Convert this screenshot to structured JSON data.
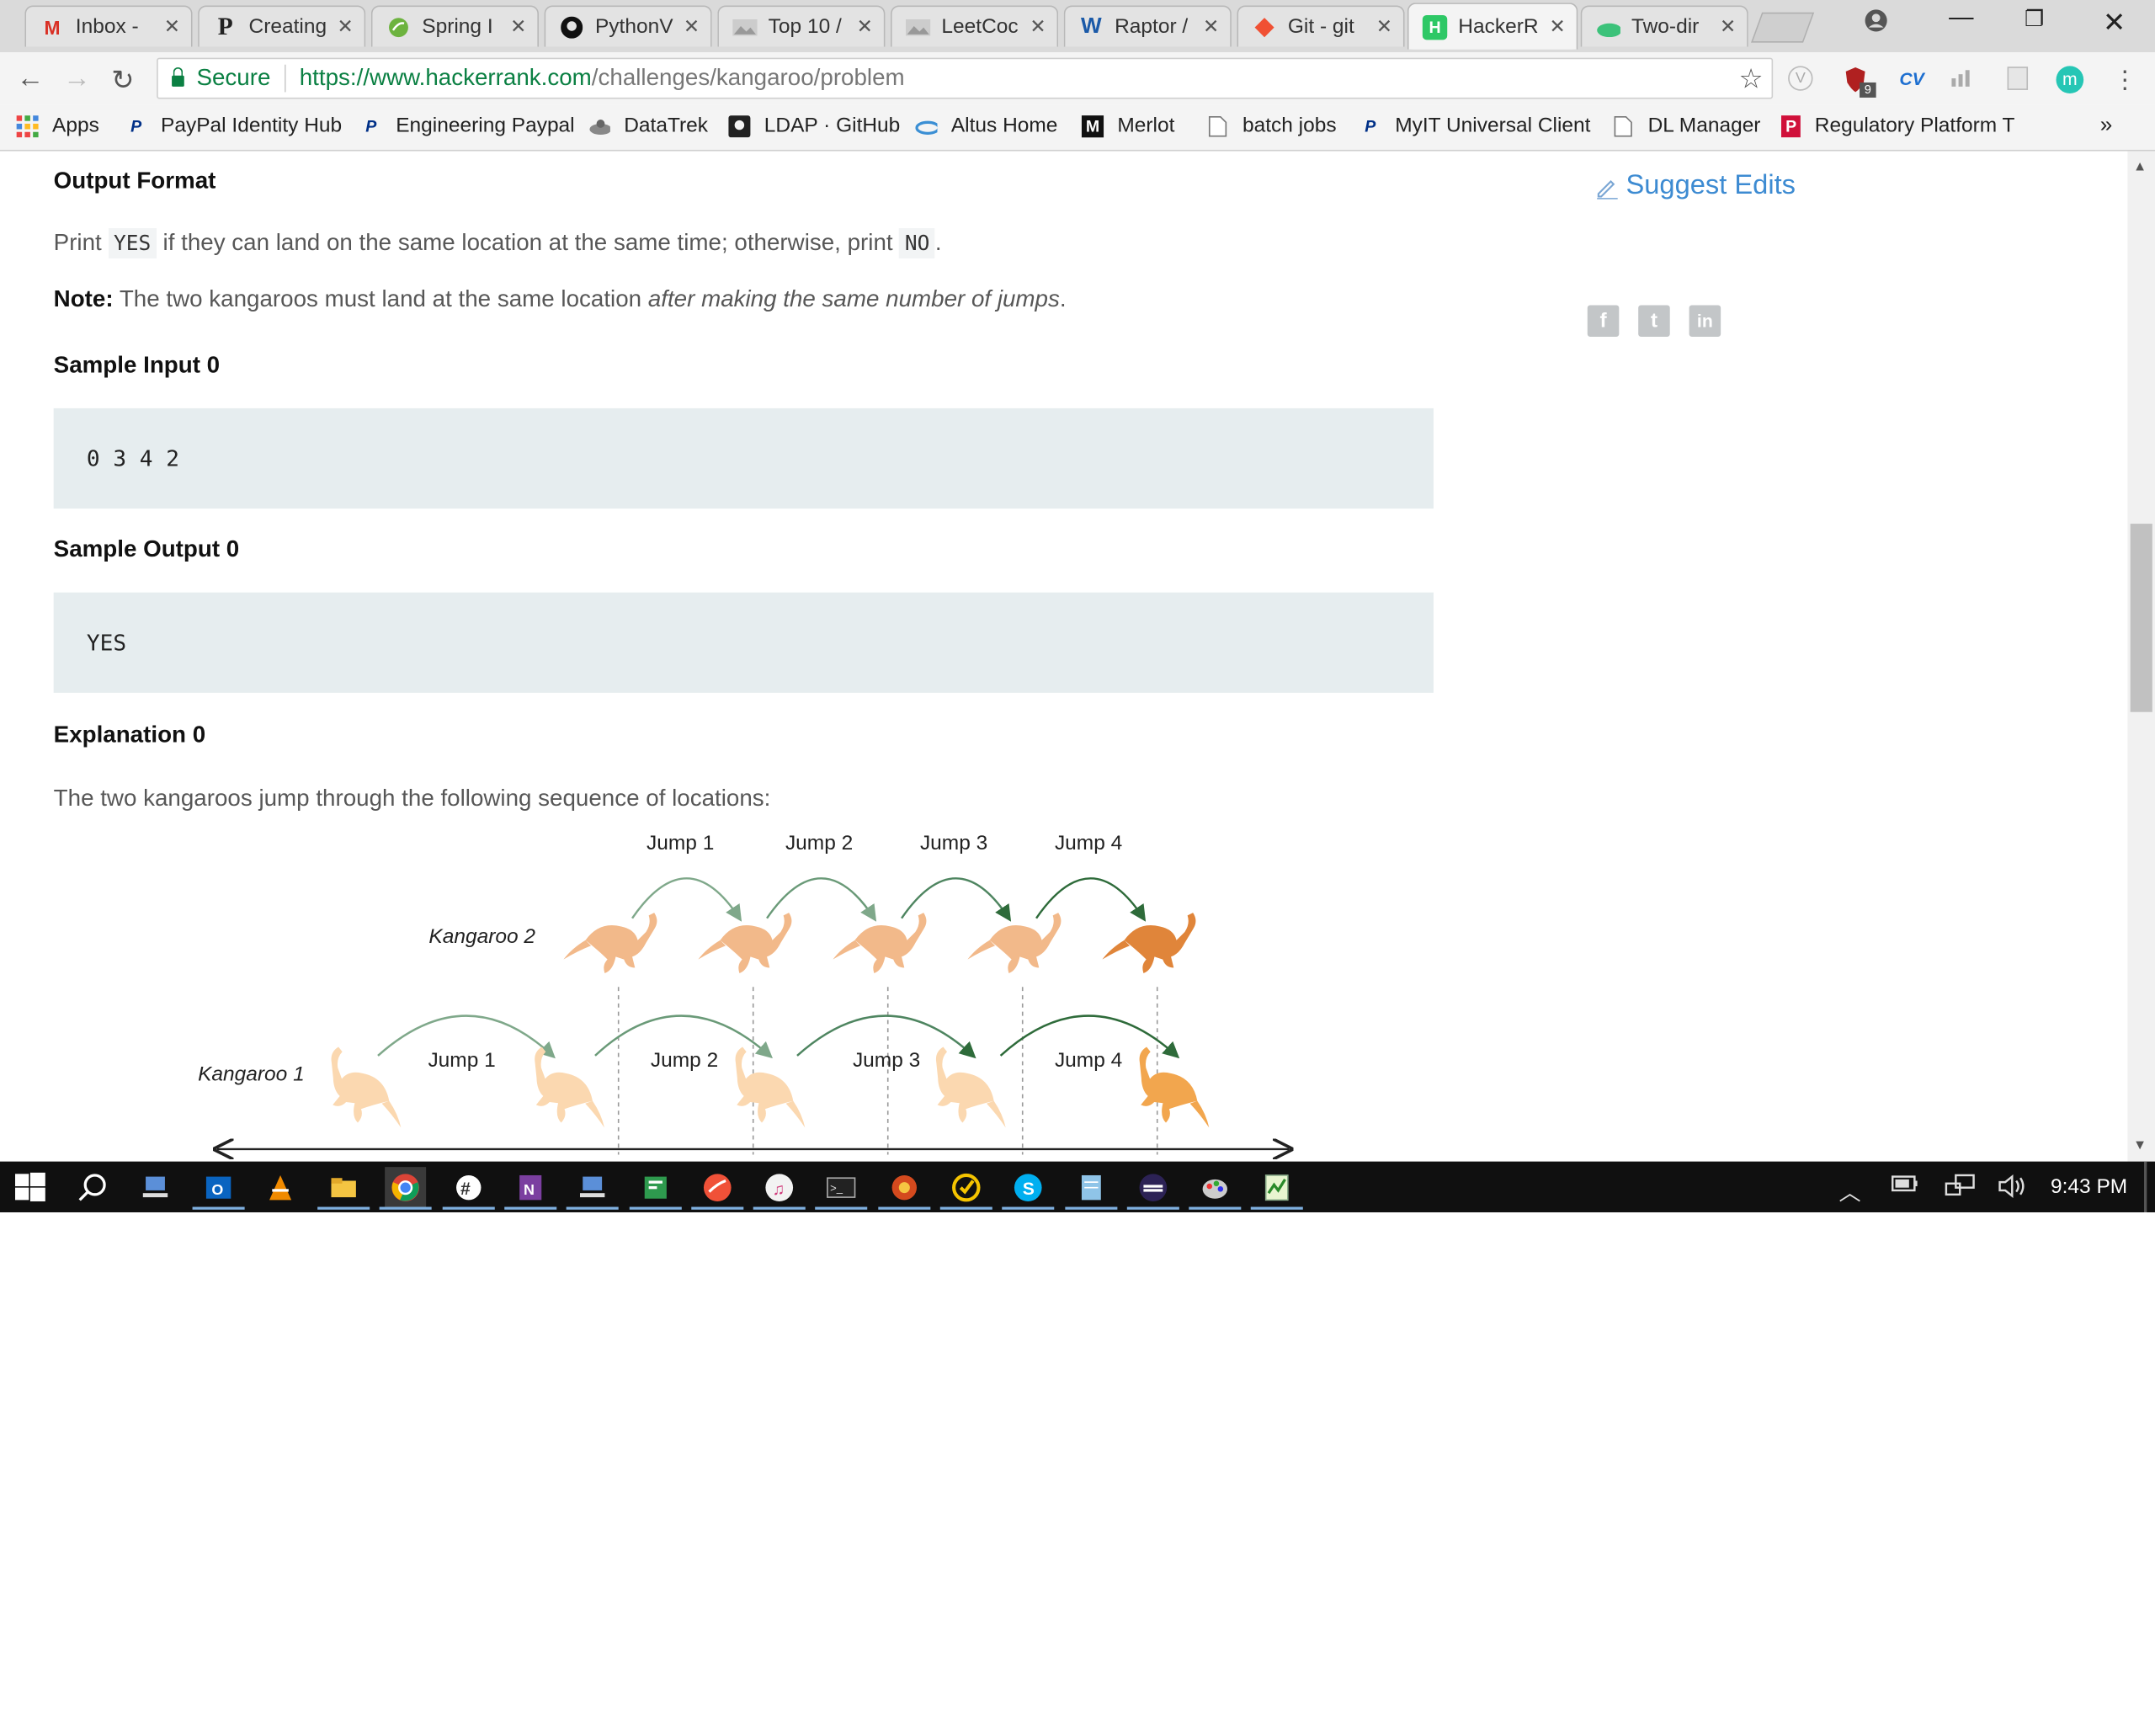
{
  "browser": {
    "tabs": [
      {
        "title": "Inbox -",
        "icon": "gmail-icon"
      },
      {
        "title": "Creating",
        "icon": "p-icon"
      },
      {
        "title": "Spring I",
        "icon": "spring-icon"
      },
      {
        "title": "PythonV",
        "icon": "github-icon"
      },
      {
        "title": "Top 10 /",
        "icon": "image-icon"
      },
      {
        "title": "LeetCoc",
        "icon": "image-icon"
      },
      {
        "title": "Raptor /",
        "icon": "raptor-icon"
      },
      {
        "title": "Git - git",
        "icon": "git-icon"
      },
      {
        "title": "HackerR",
        "icon": "hackerrank-icon"
      },
      {
        "title": "Two-dir",
        "icon": "cloud-icon"
      }
    ],
    "address": {
      "secure_label": "Secure",
      "url_scheme_host": "https://www.hackerrank.com",
      "url_path": "/challenges/kangaroo/problem"
    },
    "bookmarks": [
      {
        "label": "Apps"
      },
      {
        "label": "PayPal Identity Hub"
      },
      {
        "label": "Engineering Paypal"
      },
      {
        "label": "DataTrek"
      },
      {
        "label": "LDAP · GitHub"
      },
      {
        "label": "Altus Home"
      },
      {
        "label": "Merlot"
      },
      {
        "label": "batch jobs"
      },
      {
        "label": "MyIT Universal Client"
      },
      {
        "label": "DL Manager"
      },
      {
        "label": "Regulatory Platform T"
      }
    ],
    "bookmarks_more": "»",
    "extension_badge": "9"
  },
  "page": {
    "output_format_heading": "Output Format",
    "print_line": {
      "pre": "Print",
      "yes": "YES",
      "mid": "if they can land on the same location at the same time; otherwise, print",
      "no": "NO",
      "post": "."
    },
    "note": {
      "label": "Note:",
      "text": "The two kangaroos must land at the same location",
      "emphasis": "after making the same number of jumps",
      "post": "."
    },
    "sample_input_heading": "Sample Input 0",
    "sample_input": "0 3 4 2",
    "sample_output_heading": "Sample Output 0",
    "sample_output": "YES",
    "explanation_heading": "Explanation 0",
    "explanation_text": "The two kangaroos jump through the following sequence of locations:",
    "suggest_edits": "Suggest Edits",
    "social": [
      "f",
      "t",
      "in"
    ]
  },
  "diagram": {
    "top_labels": [
      "Jump 1",
      "Jump 2",
      "Jump 3",
      "Jump 4"
    ],
    "kangaroo2_label": "Kangaroo 2",
    "kangaroo1_label": "Kangaroo 1",
    "bottom_labels": [
      "Jump 1",
      "Jump 2",
      "Jump 3",
      "Jump 4"
    ],
    "colors": {
      "kangaroo2": "#f2b98a",
      "kangaroo2_final": "#e0853a",
      "kangaroo1": "#fbd8b0",
      "kangaroo1_final": "#f2a64e",
      "arrow_light": "#7fa88a",
      "arrow_dark": "#2e6b3a"
    }
  },
  "taskbar": {
    "clock": "9:43 PM"
  }
}
